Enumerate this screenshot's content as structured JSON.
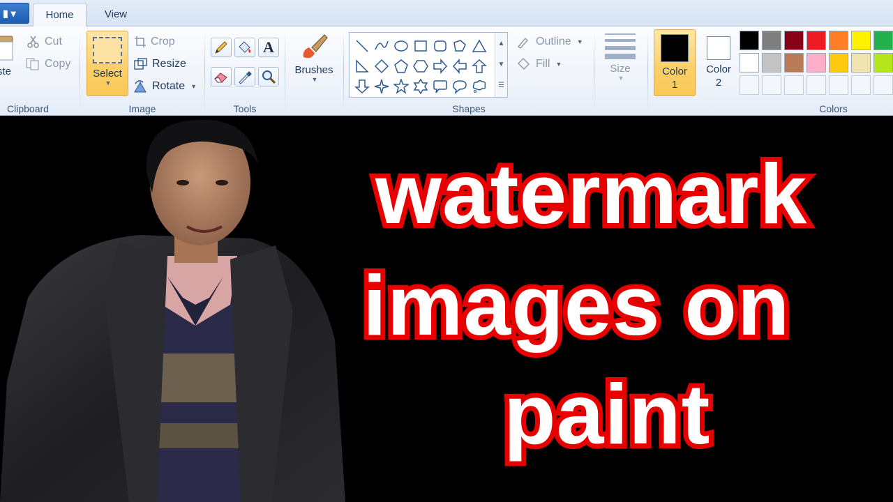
{
  "tabs": {
    "file_label": "▮ ▾",
    "home": "Home",
    "view": "View"
  },
  "clipboard": {
    "paste": "ste",
    "cut": "Cut",
    "copy": "Copy",
    "label": "Clipboard"
  },
  "image": {
    "select": "Select",
    "crop": "Crop",
    "resize": "Resize",
    "rotate": "Rotate",
    "label": "Image"
  },
  "tools": {
    "label": "Tools"
  },
  "brushes": {
    "label": "Brushes"
  },
  "shapes": {
    "label": "Shapes",
    "outline": "Outline",
    "fill": "Fill",
    "items": [
      "line",
      "curve",
      "oval",
      "rectangle",
      "rounded-rectangle",
      "polygon",
      "triangle",
      "right-triangle",
      "diamond",
      "pentagon",
      "hexagon",
      "right-arrow",
      "left-arrow",
      "up-arrow",
      "down-arrow",
      "four-point-star",
      "five-point-star",
      "six-point-star",
      "rounded-callout",
      "oval-callout",
      "cloud-callout"
    ]
  },
  "size": {
    "label": "Size"
  },
  "colors": {
    "label": "Colors",
    "color1_line1": "Color",
    "color1_line2": "1",
    "color1_value": "#000000",
    "color2_line1": "Color",
    "color2_line2": "2",
    "color2_value": "#ffffff",
    "palette": [
      "#000000",
      "#7f7f7f",
      "#880015",
      "#ed1c24",
      "#ff7f27",
      "#fff200",
      "#22b14c",
      "#ffffff",
      "#c3c3c3",
      "#b97a57",
      "#ffaec9",
      "#ffc90e",
      "#efe4b0",
      "#b5e61d",
      "",
      "",
      "",
      "",
      "",
      "",
      ""
    ]
  },
  "canvas": {
    "line1": "watermark",
    "line2": "images on",
    "line3": "paint",
    "text_fill": "#ffffff",
    "text_outline": "#e80000"
  }
}
